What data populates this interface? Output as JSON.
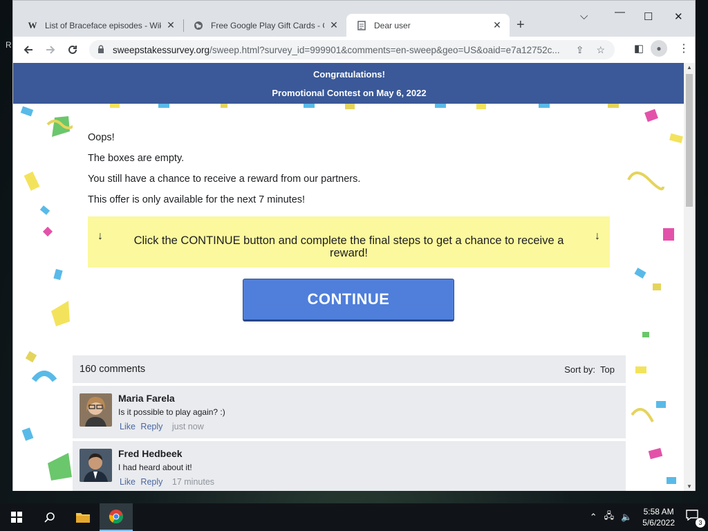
{
  "desktop": {
    "edge_letter": "R"
  },
  "browser": {
    "tabs": [
      {
        "title": "List of Braceface episodes - Wiki",
        "favicon": "W",
        "favicon_name": "wikipedia-icon"
      },
      {
        "title": "Free Google Play Gift Cards - Gift",
        "favicon": "◍",
        "favicon_name": "globe-icon"
      },
      {
        "title": "Dear user",
        "favicon": "☰",
        "favicon_name": "page-icon"
      }
    ],
    "new_tab": "+",
    "address": {
      "host": "sweepstakessurvey.org",
      "path": "/sweep.html?survey_id=999901&comments=en-sweep&geo=US&oaid=e7a12752c..."
    }
  },
  "page": {
    "header_line1": "Congratulations!",
    "header_line2_prefix": "Promotional Contest on ",
    "header_line2_date": "May 6, 2022",
    "messages": [
      "Oops!",
      "The boxes are empty.",
      "You still have a chance to receive a reward from our partners.",
      "This offer is only available for the next 7 minutes!"
    ],
    "notice_text": "Click the CONTINUE button and complete the final steps to get a chance to receive a reward!",
    "notice_arrow": "↓",
    "continue_label": "CONTINUE"
  },
  "comments": {
    "count_label": "160 comments",
    "sort_label": "Sort by:",
    "sort_value": "Top",
    "items": [
      {
        "name": "Maria Farela",
        "text": "Is it possible to play again? :)",
        "like": "Like",
        "reply": "Reply",
        "time": "just now"
      },
      {
        "name": "Fred Hedbeek",
        "text": "I had heard about it!",
        "like": "Like",
        "reply": "Reply",
        "time": "17 minutes"
      }
    ]
  },
  "taskbar": {
    "time": "5:58 AM",
    "date": "5/6/2022",
    "notification_count": "3"
  },
  "colors": {
    "header_blue": "#3b5998",
    "notice_yellow": "#fcf89d",
    "button_blue": "#4f7fdb",
    "link_blue": "#4b67a1"
  }
}
